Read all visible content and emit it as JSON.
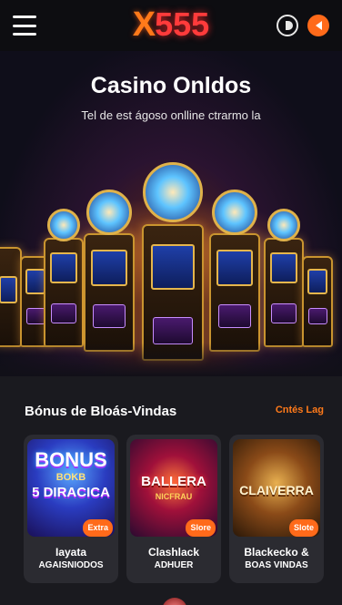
{
  "header": {
    "logo_x": "X",
    "logo_num": "555",
    "menu_icon": "hamburger-icon",
    "toggle_icon": "theme-toggle-icon",
    "action_icon": "notification-icon",
    "accent": "#ff6a1a"
  },
  "hero": {
    "title": "Casino Onldos",
    "subtitle": "Tel de est ágoso onlline ctrarmo la"
  },
  "bonus": {
    "title": "Bónus de Bloás-Vindas",
    "link": "Cntés Lag",
    "cards": [
      {
        "art_line1": "BONUS",
        "art_line2": "BOKB",
        "art_line3": "5 DIRACICA",
        "badge": "Extra",
        "line1": "Iayata",
        "line2": "AGAISNIODOS"
      },
      {
        "art_line1": "BALLERA",
        "art_line2": "NICFRAU",
        "art_line3": "",
        "badge": "Slore",
        "line1": "Clashlack",
        "line2": "ADHUER"
      },
      {
        "art_line1": "CLAIVERRA",
        "art_line2": "",
        "art_line3": "",
        "badge": "Slote",
        "line1": "Blackecko &",
        "line2": "BOAS VINDAS"
      }
    ]
  }
}
